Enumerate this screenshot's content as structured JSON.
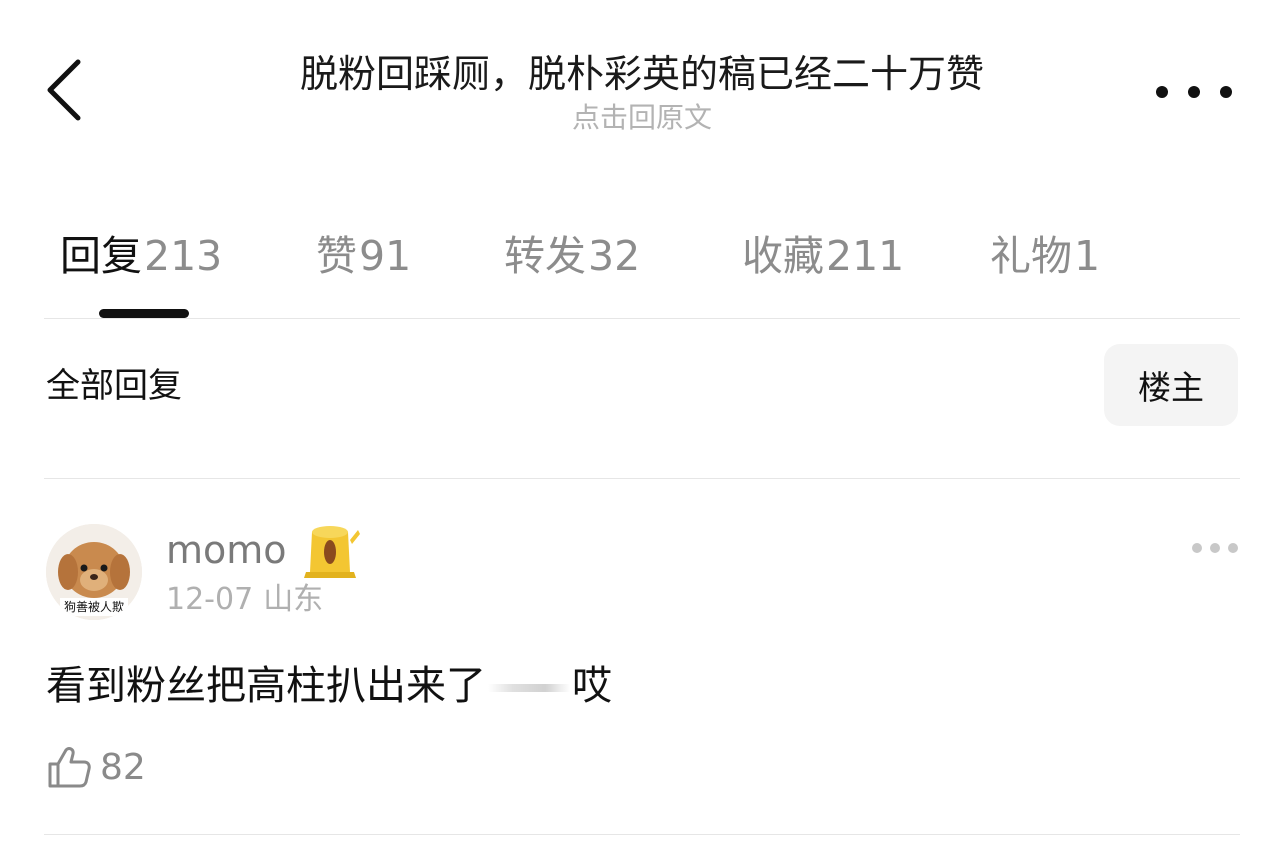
{
  "header": {
    "title": "脱粉回踩厕，脱朴彩英的稿已经二十万赞",
    "subtitle": "点击回原文"
  },
  "tabs": [
    {
      "label": "回复",
      "count": "213",
      "active": true
    },
    {
      "label": "赞",
      "count": "91",
      "active": false
    },
    {
      "label": "转发",
      "count": "32",
      "active": false
    },
    {
      "label": "收藏",
      "count": "211",
      "active": false
    },
    {
      "label": "礼物",
      "count": "1",
      "active": false
    }
  ],
  "filter": {
    "section_title": "全部回复",
    "op_button": "楼主"
  },
  "comment": {
    "username": "momo",
    "date": "12-07",
    "location": "山东",
    "text_before": "看到粉丝把高柱扒出来了",
    "text_after": "哎",
    "like_count": "82",
    "avatar_caption": "狗善被人欺"
  },
  "colors": {
    "text_primary": "#111111",
    "text_secondary": "#8c8c8c",
    "text_muted": "#b3b3b3",
    "divider": "#e6e6e6",
    "button_bg": "#f4f4f4",
    "badge_yellow": "#f3c632"
  },
  "icons": {
    "back": "chevron-left-icon",
    "more": "more-horizontal-icon",
    "like": "thumbs-up-icon",
    "badge": "tree-stump-badge-icon"
  }
}
